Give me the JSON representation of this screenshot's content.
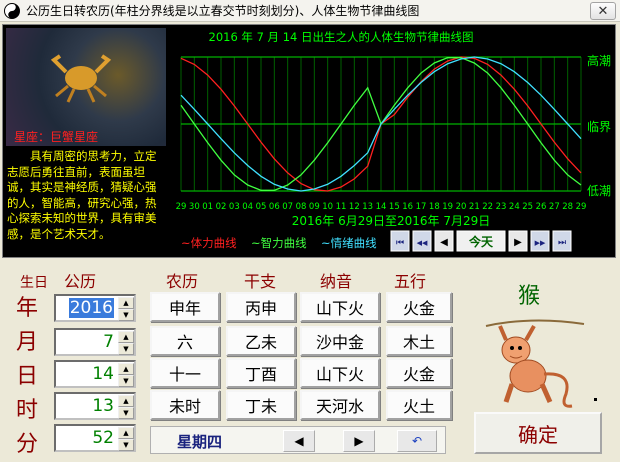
{
  "window": {
    "title": "公历生日转农历(年柱分界线是以立春交节时刻划分)、人体生物节律曲线图",
    "close_glyph": "✕"
  },
  "left_panel": {
    "star_sign": "星座：巨蟹星座",
    "description": "具有周密的思考力，立定志愿后勇往直前，表面虽坦诚，其实是神经质，猜疑心强的人，智能高，研究心强，热心探索未知的世界，具有审美感，是个艺术天才。"
  },
  "chart": {
    "title": "2016 年  7 月 14 日出生之人的人体生物节律曲线图",
    "levels": [
      "高潮",
      "临界",
      "低潮"
    ],
    "x_ticks": [
      "29",
      "30",
      "01",
      "02",
      "03",
      "04",
      "05",
      "06",
      "07",
      "08",
      "09",
      "10",
      "11",
      "12",
      "13",
      "14",
      "15",
      "16",
      "17",
      "18",
      "19",
      "20",
      "21",
      "22",
      "23",
      "24",
      "25",
      "26",
      "27",
      "28",
      "29"
    ],
    "date_range": "2016年  6月29日至2016年  7月29日",
    "legend": [
      {
        "label": "~体力曲线",
        "color": "#ff2020"
      },
      {
        "label": "~智力曲线",
        "color": "#40ff40"
      },
      {
        "label": "~情绪曲线",
        "color": "#40e0ff"
      }
    ],
    "buttons": {
      "first": "⏮",
      "prev_fast": "◀◀",
      "prev": "◀",
      "today": "今天",
      "next": "▶",
      "next_fast": "▶▶",
      "last": "⏭"
    },
    "colors": {
      "grid": "#00a000",
      "text": "#00ff00",
      "date": "#00ff00"
    }
  },
  "chart_data": {
    "type": "line",
    "title": "2016 年  7 月 14 日出生之人的人体生物节律曲线图",
    "x": [
      "29",
      "30",
      "01",
      "02",
      "03",
      "04",
      "05",
      "06",
      "07",
      "08",
      "09",
      "10",
      "11",
      "12",
      "13",
      "14",
      "15",
      "16",
      "17",
      "18",
      "19",
      "20",
      "21",
      "22",
      "23",
      "24",
      "25",
      "26",
      "27",
      "28",
      "29"
    ],
    "ylim": [
      -1,
      1
    ],
    "y_levels": [
      "低潮",
      "临界",
      "高潮"
    ],
    "series": [
      {
        "name": "体力曲线",
        "color": "#ff2020",
        "values": [
          0.98,
          0.89,
          0.73,
          0.52,
          0.27,
          0.0,
          -0.27,
          -0.52,
          -0.73,
          -0.89,
          -0.98,
          -1.0,
          -0.94,
          -0.82,
          -0.63,
          0.0,
          0.14,
          0.4,
          0.63,
          0.82,
          0.94,
          1.0,
          0.98,
          0.89,
          0.73,
          0.52,
          0.27,
          0.0,
          -0.27,
          -0.52,
          -0.73
        ]
      },
      {
        "name": "智力曲线",
        "color": "#40ff40",
        "values": [
          0.28,
          0.0,
          -0.28,
          -0.54,
          -0.76,
          -0.91,
          -0.99,
          -0.99,
          -0.91,
          -0.76,
          -0.54,
          -0.28,
          0.0,
          0.28,
          0.54,
          0.0,
          0.28,
          0.54,
          0.76,
          0.91,
          0.99,
          0.99,
          0.91,
          0.76,
          0.54,
          0.28,
          0.0,
          -0.28,
          -0.54,
          -0.76,
          -0.91
        ]
      },
      {
        "name": "情绪曲线",
        "color": "#40e0ff",
        "values": [
          0.43,
          0.22,
          0.0,
          -0.22,
          -0.43,
          -0.62,
          -0.78,
          -0.9,
          -0.97,
          -1.0,
          -0.97,
          -0.9,
          -0.78,
          -0.62,
          -0.43,
          0.0,
          0.22,
          0.43,
          0.62,
          0.78,
          0.9,
          0.97,
          1.0,
          0.97,
          0.9,
          0.78,
          0.62,
          0.43,
          0.22,
          0.0,
          -0.22
        ]
      }
    ]
  },
  "table": {
    "headers": {
      "birth": "生日",
      "solar": "公历",
      "lunar": "农历",
      "ganzhi": "干支",
      "nayin": "纳音",
      "wuxing": "五行"
    },
    "rows": [
      {
        "label": "年",
        "solar": "2016",
        "lunar": "申年",
        "ganzhi": "丙申",
        "nayin": "山下火",
        "wuxing": "火金"
      },
      {
        "label": "月",
        "solar": "7",
        "lunar": "六",
        "ganzhi": "乙未",
        "nayin": "沙中金",
        "wuxing": "木土"
      },
      {
        "label": "日",
        "solar": "14",
        "lunar": "十一",
        "ganzhi": "丁酉",
        "nayin": "山下火",
        "wuxing": "火金"
      },
      {
        "label": "时",
        "solar": "13",
        "lunar": "未时",
        "ganzhi": "丁未",
        "nayin": "天河水",
        "wuxing": "火土"
      },
      {
        "label": "分",
        "solar": "52"
      }
    ],
    "weekday": "星期四",
    "nav": {
      "prev": "◀",
      "next": "▶",
      "reset": "↶"
    }
  },
  "zodiac": {
    "animal": "猴",
    "icon": "monkey-icon"
  },
  "confirm": {
    "label": "确定"
  }
}
